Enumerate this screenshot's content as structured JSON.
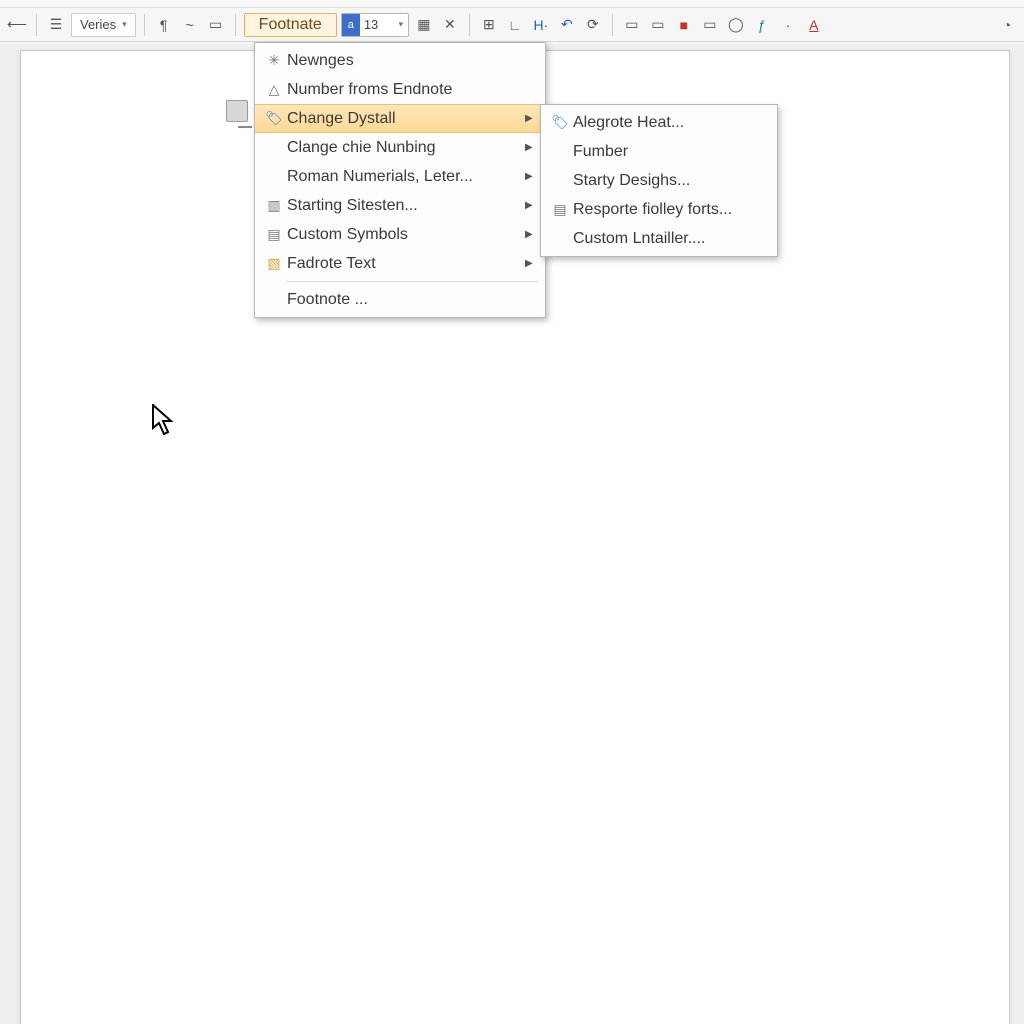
{
  "toolbar": {
    "style_name": "Veries",
    "active_menu": "Footnate",
    "font_size": "13"
  },
  "menu_main": {
    "items": [
      {
        "label": "Newnges",
        "has_sub": false
      },
      {
        "label": "Number froms Endnote",
        "has_sub": false
      },
      {
        "label": "Change Dystall",
        "has_sub": true,
        "highlight": true
      },
      {
        "label": "Clange chie Nunbing",
        "has_sub": true
      },
      {
        "label": "Roman Numerials, Leter...",
        "has_sub": true
      },
      {
        "label": "Starting Sitesten...",
        "has_sub": true
      },
      {
        "label": "Custom Symbols",
        "has_sub": true
      },
      {
        "label": "Fadrote Text",
        "has_sub": true
      },
      {
        "label": "Footnote ...",
        "has_sub": false
      }
    ]
  },
  "menu_sub": {
    "items": [
      {
        "label": "Alegrote Heat..."
      },
      {
        "label": "Fumber"
      },
      {
        "label": "Starty Desighs..."
      },
      {
        "label": "Resporte fiolley forts..."
      },
      {
        "label": "Custom Lntailler...."
      }
    ]
  }
}
